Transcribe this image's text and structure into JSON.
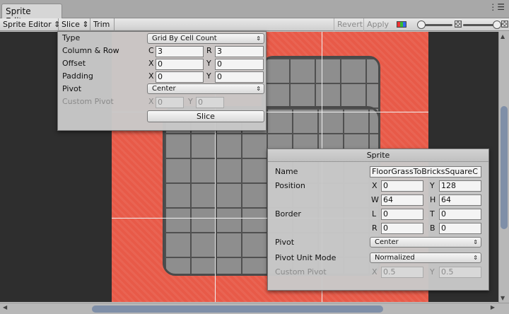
{
  "window": {
    "tab": "Sprite Editor"
  },
  "toolbar": {
    "sprite_editor": "Sprite Editor ⇕",
    "slice": "Slice ⇕",
    "trim": "Trim",
    "revert": "Revert",
    "apply": "Apply"
  },
  "slice_panel": {
    "type_label": "Type",
    "type_value": "Grid By Cell Count",
    "colrow_label": "Column & Row",
    "c_axis": "C",
    "c_value": "3",
    "r_axis": "R",
    "r_value": "3",
    "offset_label": "Offset",
    "offset_x": "0",
    "offset_y": "0",
    "padding_label": "Padding",
    "padding_x": "0",
    "padding_y": "0",
    "pivot_label": "Pivot",
    "pivot_value": "Center",
    "custom_pivot_label": "Custom Pivot",
    "custom_pivot_x": "0",
    "custom_pivot_y": "0",
    "slice_button": "Slice",
    "x_axis": "X",
    "y_axis": "Y"
  },
  "sprite_panel": {
    "title": "Sprite",
    "name_label": "Name",
    "name_value": "FloorGrassToBricksSquareC",
    "position_label": "Position",
    "x_axis": "X",
    "x_value": "0",
    "y_axis": "Y",
    "y_value": "128",
    "w_axis": "W",
    "w_value": "64",
    "h_axis": "H",
    "h_value": "64",
    "border_label": "Border",
    "l_axis": "L",
    "l_value": "0",
    "t_axis": "T",
    "t_value": "0",
    "r_axis": "R",
    "r_value": "0",
    "b_axis": "B",
    "b_value": "0",
    "pivot_label": "Pivot",
    "pivot_value": "Center",
    "pivot_unit_label": "Pivot Unit Mode",
    "pivot_unit_value": "Normalized",
    "custom_pivot_label": "Custom Pivot",
    "custom_pivot_x": "0.5",
    "custom_pivot_y": "0.5"
  },
  "colors": {
    "sprite_background": "#e85a48",
    "tiles": "#8e8e8e",
    "scrollbar_thumb": "#7f8fa8"
  },
  "icons": [
    "menu-icon",
    "rgb-channel-icon",
    "zoom-slider",
    "checker-icon",
    "dropdown-arrow-icon"
  ],
  "scroll": {
    "horizontal_position": 0.35,
    "vertical_position": 0.45
  }
}
